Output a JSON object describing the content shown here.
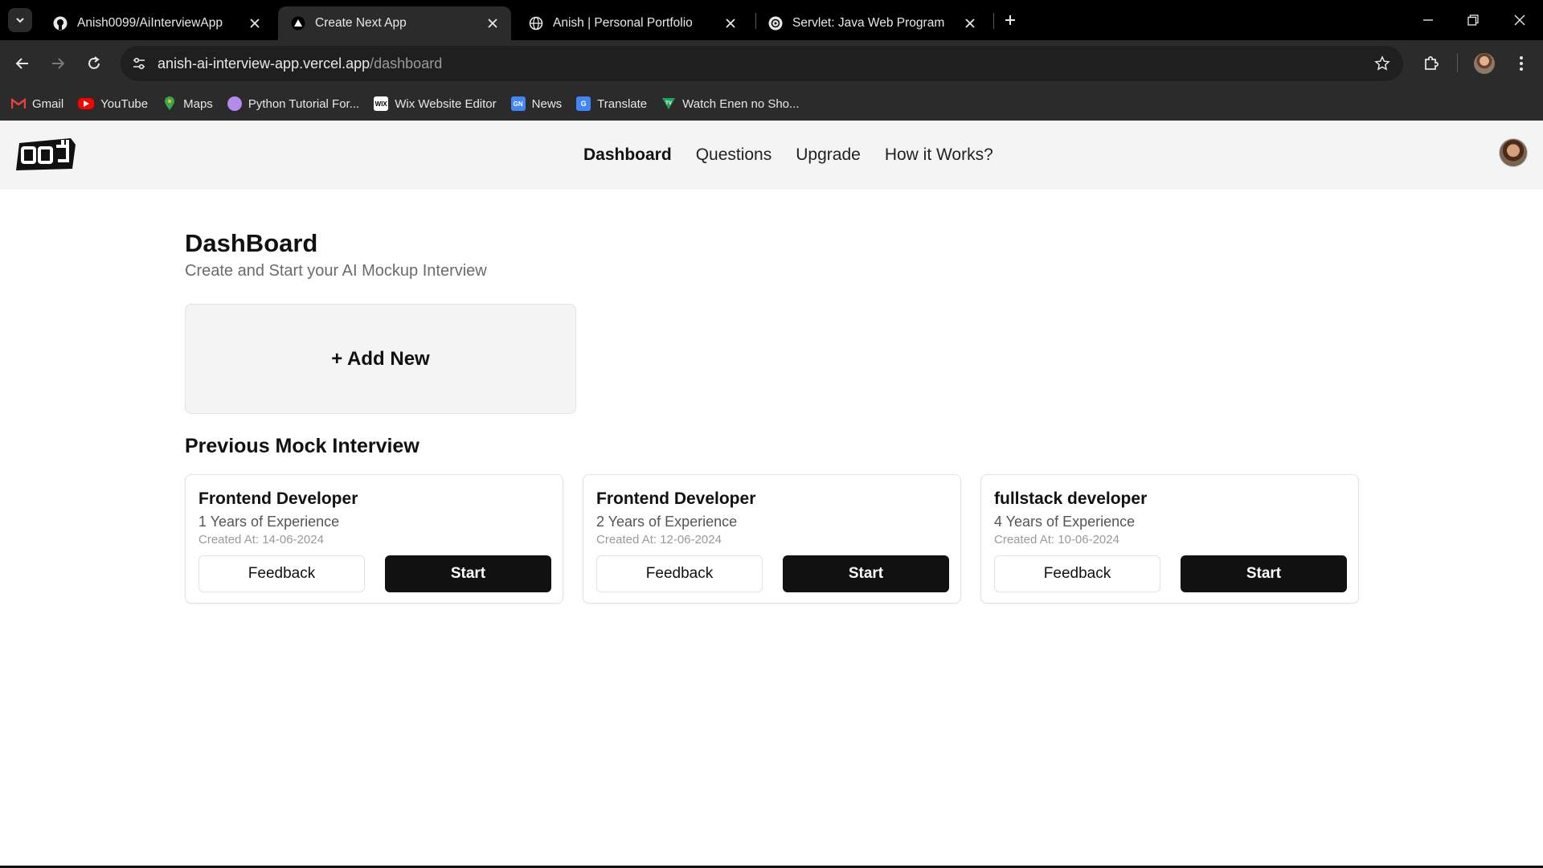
{
  "browser": {
    "tabs": [
      {
        "title": "Anish0099/AiInterviewApp",
        "icon": "github-icon",
        "active": false
      },
      {
        "title": "Create Next App",
        "icon": "vercel-icon",
        "active": true
      },
      {
        "title": "Anish | Personal Portfolio",
        "icon": "globe-icon",
        "active": false
      },
      {
        "title": "Servlet: Java Web Program",
        "icon": "chatgpt-icon",
        "active": false
      }
    ],
    "url_host": "anish-ai-interview-app.vercel.app",
    "url_path": "/dashboard",
    "bookmarks": [
      {
        "label": "Gmail",
        "icon": "gmail-icon",
        "color": "#ea4335"
      },
      {
        "label": "YouTube",
        "icon": "youtube-icon",
        "color": "#ff0000"
      },
      {
        "label": "Maps",
        "icon": "maps-icon",
        "color": "#34a853"
      },
      {
        "label": "Python Tutorial For...",
        "icon": "python-icon",
        "color": "#b38be8"
      },
      {
        "label": "Wix Website Editor",
        "icon": "wix-icon",
        "color": "#ffffff"
      },
      {
        "label": "News",
        "icon": "news-icon",
        "color": "#4285f4"
      },
      {
        "label": "Translate",
        "icon": "translate-icon",
        "color": "#4285f4"
      },
      {
        "label": "Watch Enen no Sho...",
        "icon": "tv-icon",
        "color": "#23a559"
      }
    ]
  },
  "header": {
    "nav": [
      "Dashboard",
      "Questions",
      "Upgrade",
      "How it Works?"
    ],
    "active_nav": "Dashboard"
  },
  "dashboard": {
    "title": "DashBoard",
    "subtitle": "Create and Start your AI Mockup Interview",
    "add_new_label": "+ Add New",
    "previous_title": "Previous Mock Interview",
    "interviews": [
      {
        "role": "Frontend Developer",
        "experience": "1 Years of Experience",
        "created": "Created At: 14-06-2024",
        "feedback_label": "Feedback",
        "start_label": "Start"
      },
      {
        "role": "Frontend Developer",
        "experience": "2 Years of Experience",
        "created": "Created At: 12-06-2024",
        "feedback_label": "Feedback",
        "start_label": "Start"
      },
      {
        "role": "fullstack developer",
        "experience": "4 Years of Experience",
        "created": "Created At: 10-06-2024",
        "feedback_label": "Feedback",
        "start_label": "Start"
      }
    ]
  },
  "colors": {
    "primary": "#111111",
    "header_bg": "#f4f4f4",
    "muted": "#6b6b6b"
  }
}
